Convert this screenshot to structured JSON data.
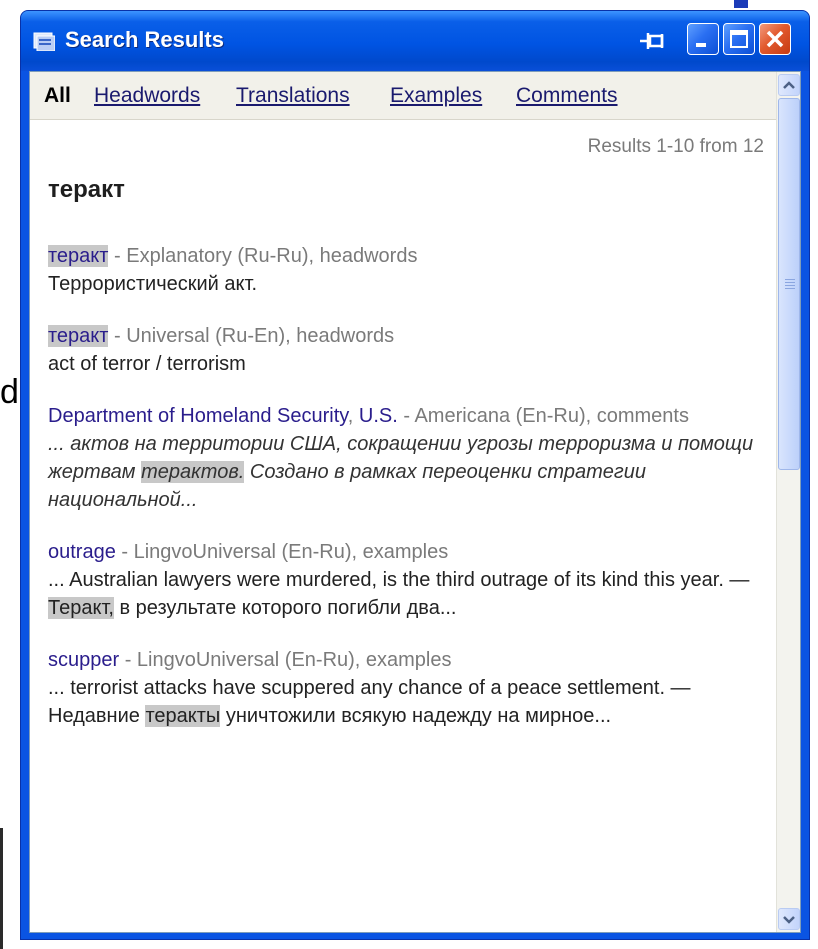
{
  "background": {
    "partial_letter": "d"
  },
  "window": {
    "title": "Search Results",
    "buttons": [
      "pin-icon",
      "minimize-icon",
      "maximize-icon",
      "close-icon"
    ]
  },
  "filters": [
    {
      "label": "All",
      "active": true
    },
    {
      "label": "Headwords",
      "active": false
    },
    {
      "label": "Translations",
      "active": false
    },
    {
      "label": "Examples",
      "active": false
    },
    {
      "label": "Comments",
      "active": false
    }
  ],
  "results_count": "Results 1-10 from 12",
  "query": "теракт",
  "results": [
    {
      "headword": "теракт",
      "source": " - Explanatory (Ru-Ru), headwords",
      "text": "Террористический акт."
    },
    {
      "headword": "теракт",
      "source": " - Universal (Ru-En), headwords",
      "text": "act of terror / terrorism"
    },
    {
      "headword_part1": "Department of Homeland Security",
      "headword_sep": ", ",
      "headword_part2": "U.S.",
      "source": " - Americana (En-Ru), comments",
      "text_before": "... актов на территории США, сокращении угрозы терроризма и помощи жертвам ",
      "highlight": "терактов.",
      "text_after": " Создано в рамках переоценки стратегии национальной..."
    },
    {
      "headword": "outrage",
      "source": " - LingvoUniversal (En-Ru), examples",
      "text_before": "... Australian lawyers were murdered, is the third outrage of its kind this year. — ",
      "highlight": "Теракт,",
      "text_after": " в результате которого погибли два..."
    },
    {
      "headword": "scupper",
      "source": " - LingvoUniversal (En-Ru), examples",
      "text_before": "... terrorist attacks have scuppered any chance of a peace settlement. — Недавние ",
      "highlight": "теракты",
      "text_after": " уничтожили всякую надежду на мирное..."
    }
  ],
  "colors": {
    "titlebar": "#0054e3",
    "headword": "#2a1d8c",
    "source": "#7a7a7a",
    "highlight": "#c8c8c8"
  }
}
